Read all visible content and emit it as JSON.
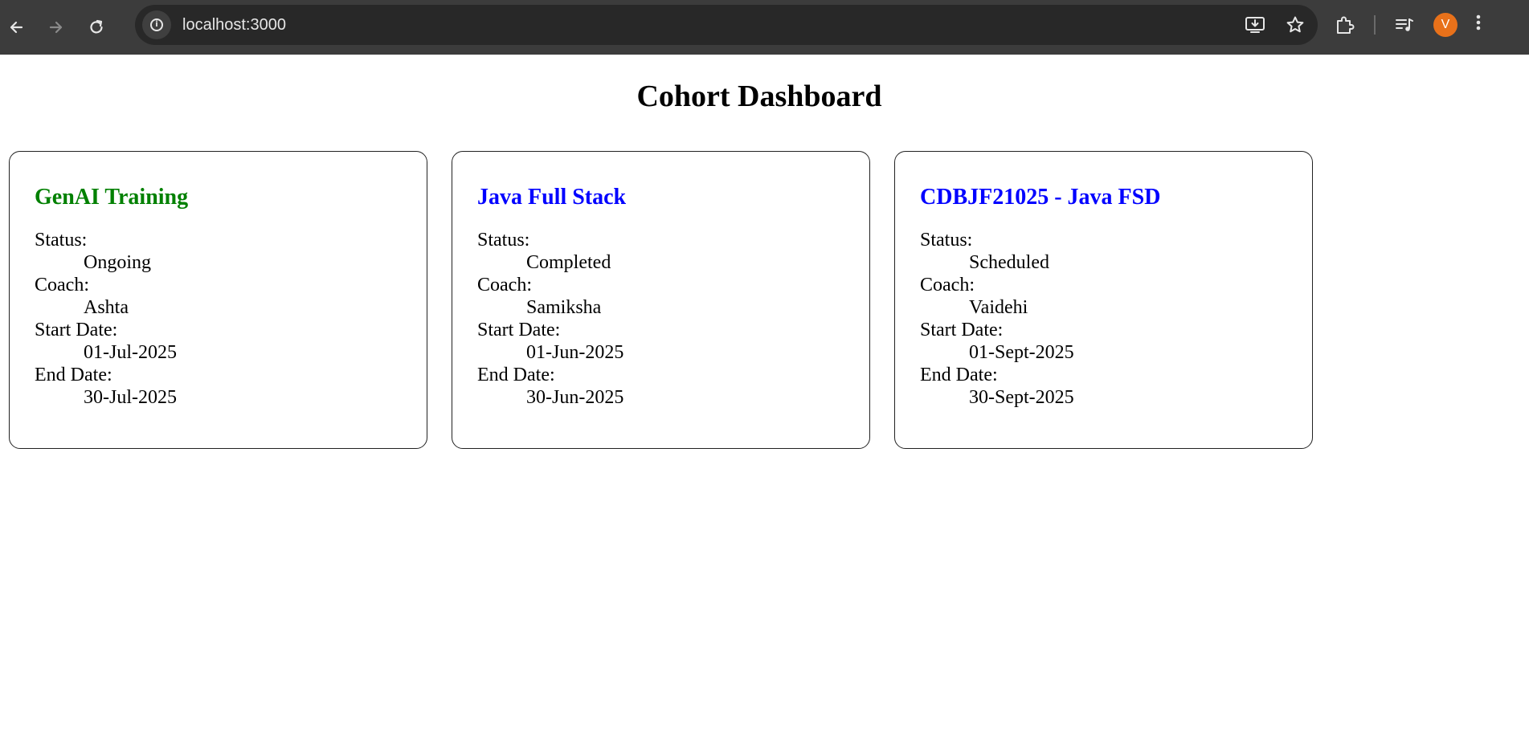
{
  "browser": {
    "url": "localhost:3000",
    "avatar_letter": "V",
    "icons": {
      "back": "arrow-left-icon",
      "forward": "arrow-right-icon",
      "reload": "reload-icon",
      "site_info": "info-icon",
      "install": "install-app-icon",
      "bookmark": "star-icon",
      "extensions": "puzzle-icon",
      "media": "media-control-icon",
      "menu": "kebab-menu-icon"
    },
    "colors": {
      "chrome_bg": "#3c3c3c",
      "omnibox_bg": "#282828",
      "avatar_bg": "#e8711a"
    }
  },
  "page": {
    "title": "Cohort Dashboard"
  },
  "cohorts": [
    {
      "name": "GenAI Training",
      "title_color": "#008000",
      "status_label": "Status:",
      "status": "Ongoing",
      "coach_label": "Coach:",
      "coach": "Ashta",
      "start_label": "Start Date:",
      "start_date": "01-Jul-2025",
      "end_label": "End Date:",
      "end_date": "30-Jul-2025"
    },
    {
      "name": "Java Full Stack",
      "title_color": "#0000ff",
      "status_label": "Status:",
      "status": "Completed",
      "coach_label": "Coach:",
      "coach": "Samiksha",
      "start_label": "Start Date:",
      "start_date": "01-Jun-2025",
      "end_label": "End Date:",
      "end_date": "30-Jun-2025"
    },
    {
      "name": "CDBJF21025 - Java FSD",
      "title_color": "#0000ff",
      "status_label": "Status:",
      "status": "Scheduled",
      "coach_label": "Coach:",
      "coach": "Vaidehi",
      "start_label": "Start Date:",
      "start_date": "01-Sept-2025",
      "end_label": "End Date:",
      "end_date": "30-Sept-2025"
    }
  ]
}
